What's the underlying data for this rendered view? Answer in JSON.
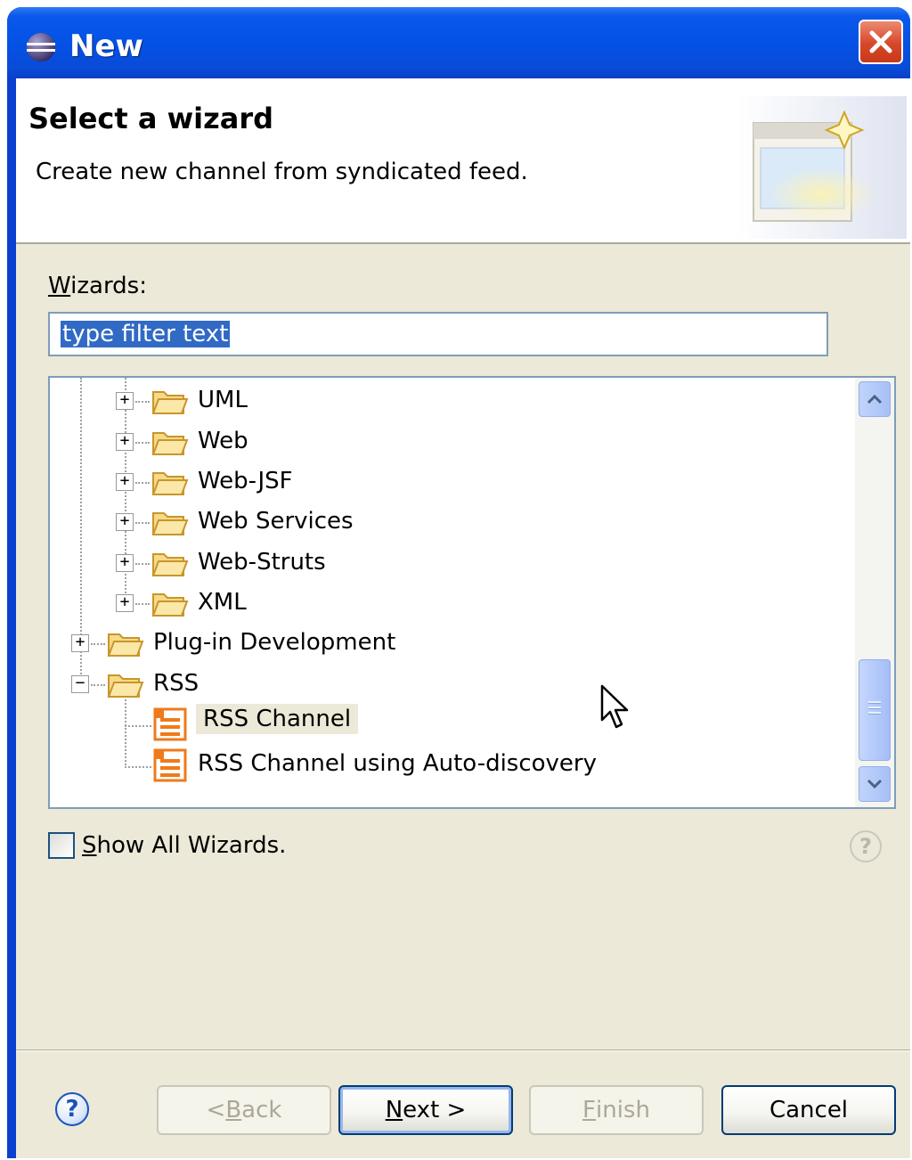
{
  "window": {
    "title": "New"
  },
  "header": {
    "title": "Select a wizard",
    "description": "Create new channel from syndicated feed."
  },
  "wizards_label_prefix": "W",
  "wizards_label_rest": "izards:",
  "filter": {
    "value": "type filter text"
  },
  "tree": {
    "items": [
      {
        "label": "UML",
        "type": "folder",
        "level": 2,
        "expanded": false
      },
      {
        "label": "Web",
        "type": "folder",
        "level": 2,
        "expanded": false
      },
      {
        "label": "Web-JSF",
        "type": "folder",
        "level": 2,
        "expanded": false
      },
      {
        "label": "Web Services",
        "type": "folder",
        "level": 2,
        "expanded": false
      },
      {
        "label": "Web-Struts",
        "type": "folder",
        "level": 2,
        "expanded": false
      },
      {
        "label": "XML",
        "type": "folder",
        "level": 2,
        "expanded": false
      },
      {
        "label": "Plug-in Development",
        "type": "folder",
        "level": 1,
        "expanded": false
      },
      {
        "label": "RSS",
        "type": "folder",
        "level": 1,
        "expanded": true
      },
      {
        "label": "RSS Channel",
        "type": "wizard",
        "level": 2,
        "selected": true
      },
      {
        "label": "RSS Channel using Auto-discovery",
        "type": "wizard",
        "level": 2,
        "selected": false
      }
    ]
  },
  "show_all": {
    "mnemonic": "S",
    "rest": "how All Wizards.",
    "checked": false
  },
  "buttons": {
    "back": {
      "prefix": "< ",
      "mnemonic": "B",
      "rest": "ack",
      "enabled": false
    },
    "next": {
      "mnemonic": "N",
      "rest": "ext >",
      "enabled": true
    },
    "finish": {
      "mnemonic": "F",
      "rest": "inish",
      "enabled": false
    },
    "cancel": {
      "label": "Cancel",
      "enabled": true
    }
  },
  "help_glyph": "?",
  "colors": {
    "titlebar": "#0452e6",
    "selection": "#316ac5",
    "rss_icon": "#f07a1a",
    "folder": "#f2c56a"
  }
}
